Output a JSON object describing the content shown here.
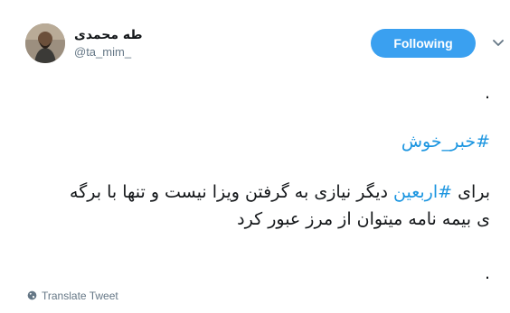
{
  "user": {
    "display_name": "طه محمدی",
    "handle": "@ta_mim_",
    "avatar_icon": "profile-photo"
  },
  "follow_button": {
    "label": "Following",
    "color": "#3aa0f0"
  },
  "menu_icon": "chevron-down-icon",
  "tweet": {
    "line1": ".",
    "hashtag1": "#خبر_خوش",
    "line3_prefix": "برای ",
    "hashtag2": "#اربعین",
    "line3_rest": " دیگر نیازی به گرفتن ویزا نیست و تنها با برگه",
    "line4": "ی بیمه نامه میتوان از مرز عبور کرد",
    "line5": ".",
    "hashtag_color": "#1b95e0"
  },
  "translate": {
    "label": "Translate Tweet",
    "icon": "globe-icon"
  }
}
